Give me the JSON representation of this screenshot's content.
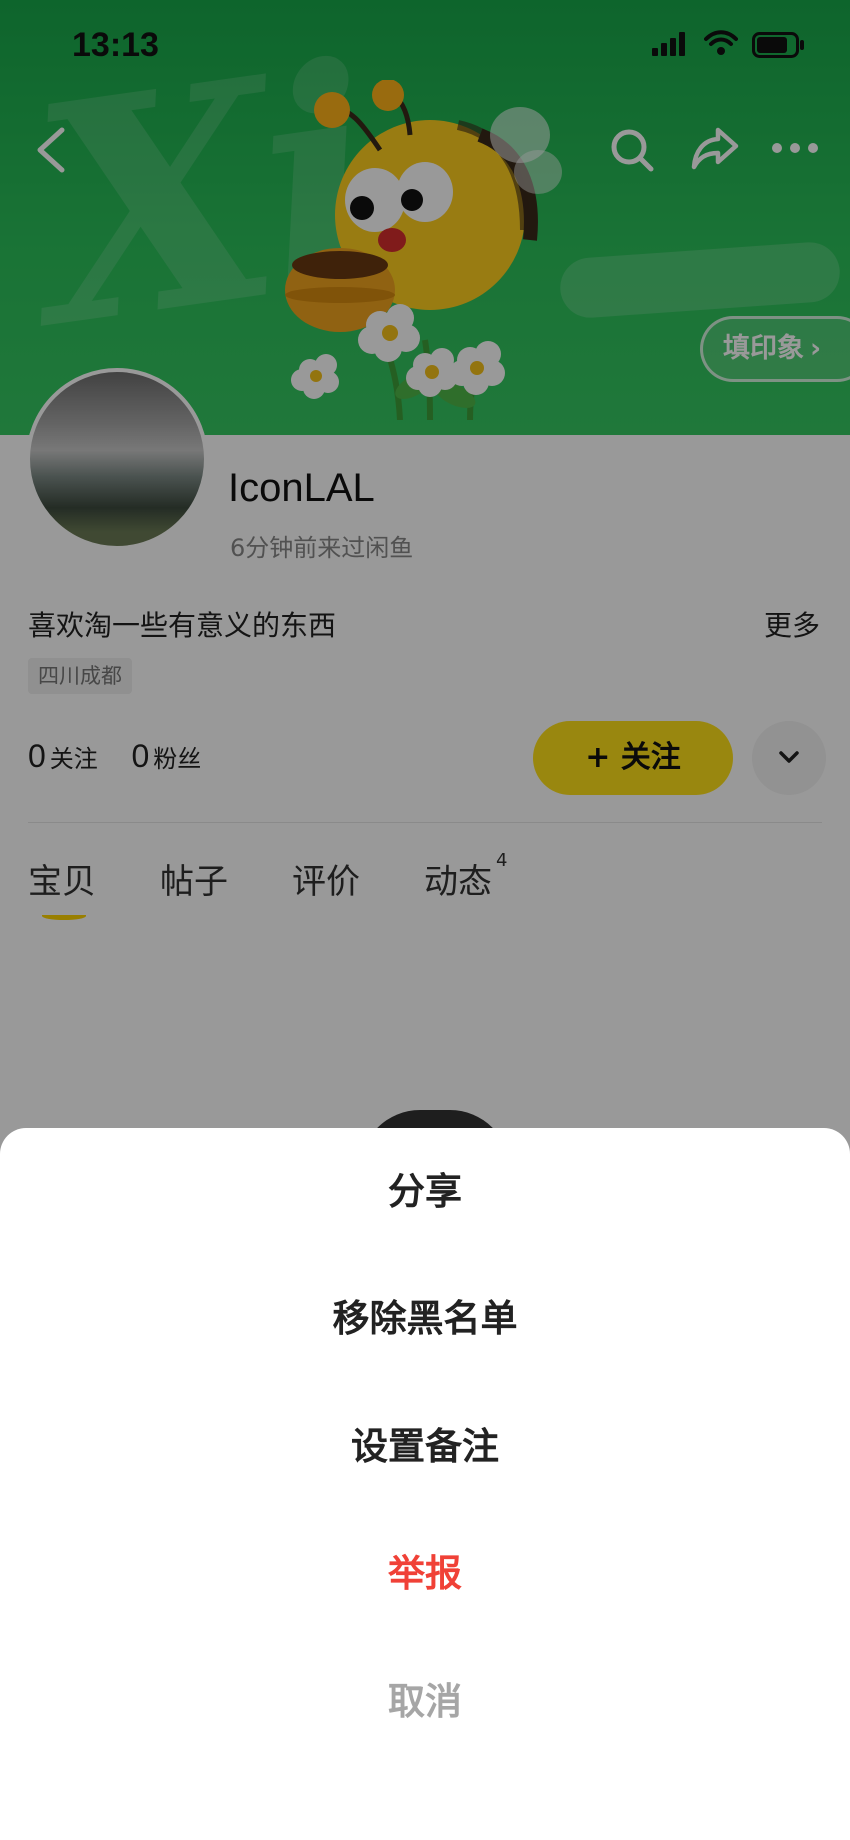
{
  "status_bar": {
    "time": "13:13"
  },
  "profile": {
    "impression_button": "填印象",
    "username": "IconLAL",
    "last_seen": "6分钟前来过闲鱼",
    "bio": "喜欢淘一些有意义的东西",
    "more_label": "更多",
    "location": "四川成都",
    "following_count": "0",
    "following_label": "关注",
    "followers_count": "0",
    "followers_label": "粉丝",
    "follow_button": "+ 关注"
  },
  "tabs": [
    {
      "label": "宝贝"
    },
    {
      "label": "帖子"
    },
    {
      "label": "评价"
    },
    {
      "label": "动态",
      "badge": "4"
    }
  ],
  "action_sheet": {
    "items": [
      {
        "label": "分享"
      },
      {
        "label": "移除黑名单"
      },
      {
        "label": "设置备注"
      },
      {
        "label": "举报",
        "color": "#f04137"
      },
      {
        "label": "取消",
        "color": "#a6a6a6"
      }
    ]
  },
  "colors": {
    "banner_green": "#2bc05a",
    "follow_yellow": "#ffe21a",
    "danger_red": "#f04137"
  },
  "icons": [
    "back-icon",
    "search-icon",
    "share-icon",
    "more-icon",
    "chevron-right-icon",
    "chevron-down-icon",
    "signal-icon",
    "wifi-icon",
    "battery-icon"
  ]
}
